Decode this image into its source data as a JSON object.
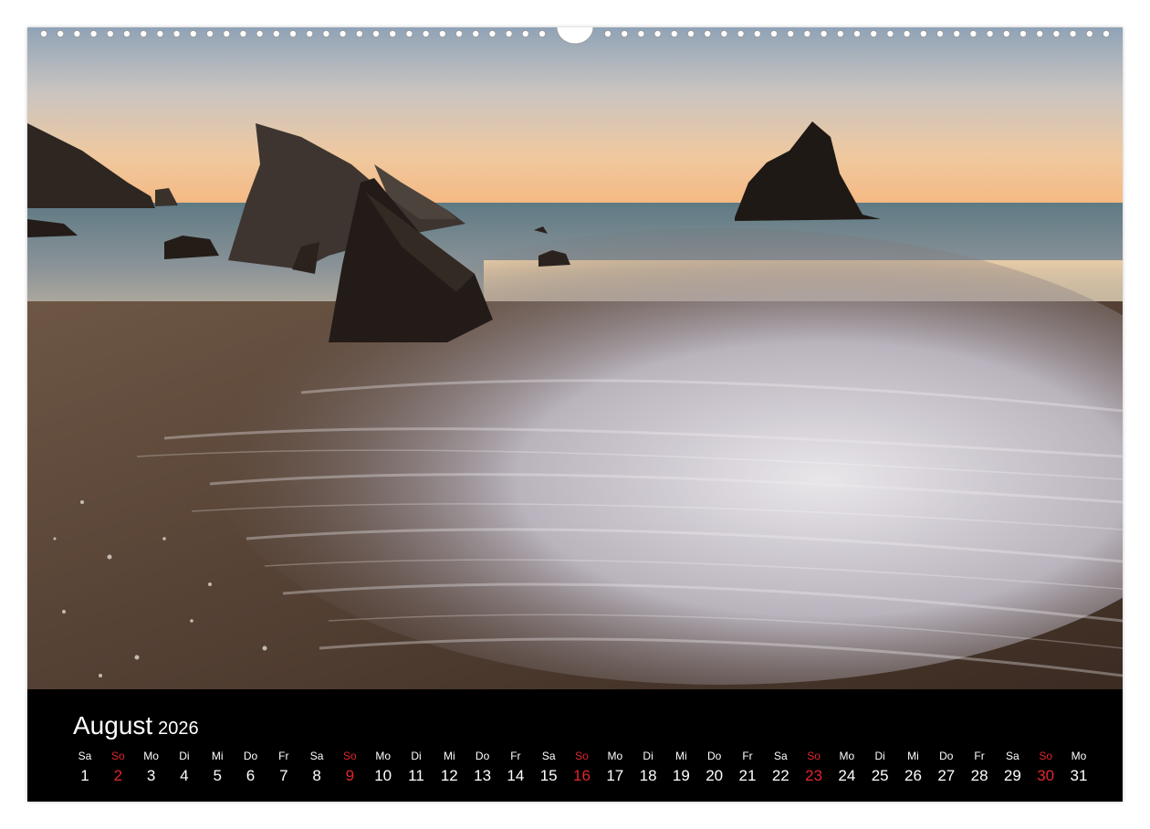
{
  "calendar": {
    "month": "August",
    "year": "2026",
    "sunday_color": "#e0262b",
    "days": [
      {
        "dow": "Sa",
        "num": "1"
      },
      {
        "dow": "So",
        "num": "2"
      },
      {
        "dow": "Mo",
        "num": "3"
      },
      {
        "dow": "Di",
        "num": "4"
      },
      {
        "dow": "Mi",
        "num": "5"
      },
      {
        "dow": "Do",
        "num": "6"
      },
      {
        "dow": "Fr",
        "num": "7"
      },
      {
        "dow": "Sa",
        "num": "8"
      },
      {
        "dow": "So",
        "num": "9"
      },
      {
        "dow": "Mo",
        "num": "10"
      },
      {
        "dow": "Di",
        "num": "11"
      },
      {
        "dow": "Mi",
        "num": "12"
      },
      {
        "dow": "Do",
        "num": "13"
      },
      {
        "dow": "Fr",
        "num": "14"
      },
      {
        "dow": "Sa",
        "num": "15"
      },
      {
        "dow": "So",
        "num": "16"
      },
      {
        "dow": "Mo",
        "num": "17"
      },
      {
        "dow": "Di",
        "num": "18"
      },
      {
        "dow": "Mi",
        "num": "19"
      },
      {
        "dow": "Do",
        "num": "20"
      },
      {
        "dow": "Fr",
        "num": "21"
      },
      {
        "dow": "Sa",
        "num": "22"
      },
      {
        "dow": "So",
        "num": "23"
      },
      {
        "dow": "Mo",
        "num": "24"
      },
      {
        "dow": "Di",
        "num": "25"
      },
      {
        "dow": "Mi",
        "num": "26"
      },
      {
        "dow": "Do",
        "num": "27"
      },
      {
        "dow": "Fr",
        "num": "28"
      },
      {
        "dow": "Sa",
        "num": "29"
      },
      {
        "dow": "So",
        "num": "30"
      },
      {
        "dow": "Mo",
        "num": "31"
      }
    ]
  },
  "photo": {
    "subject": "sunset-seascape-icon"
  }
}
